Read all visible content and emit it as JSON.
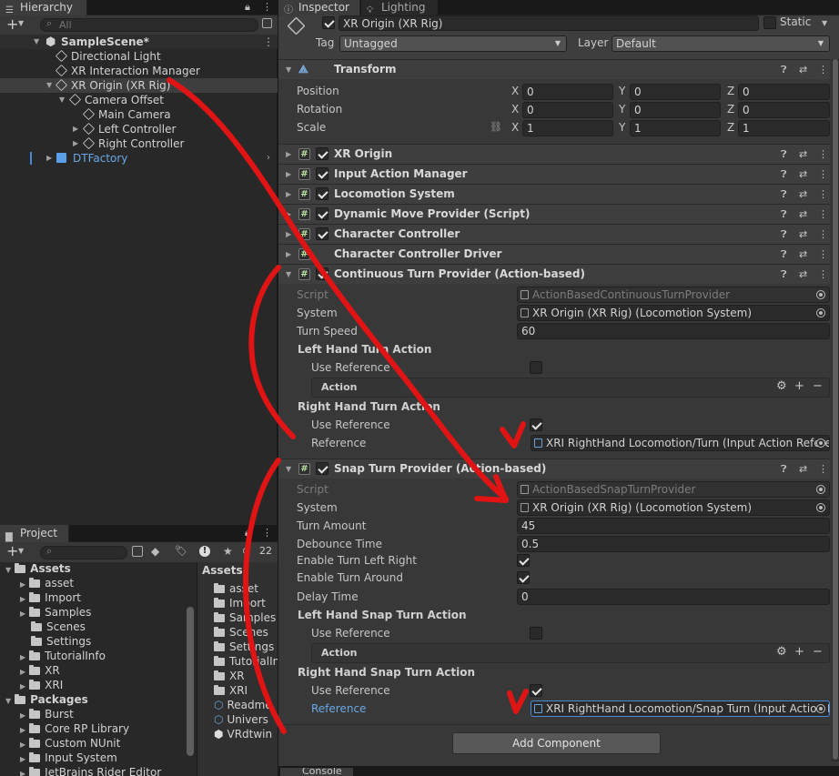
{
  "colors": {
    "annotation_red": "#e01414",
    "link_blue": "#69a8e6",
    "selected_row": "#3e3e3e"
  },
  "hierarchy": {
    "tab_label": "Hierarchy",
    "search_placeholder": "All",
    "scene": "SampleScene*",
    "items": [
      {
        "label": "Directional Light"
      },
      {
        "label": "XR Interaction Manager"
      },
      {
        "label": "XR Origin (XR Rig)"
      },
      {
        "label": "Camera Offset"
      },
      {
        "label": "Main Camera"
      },
      {
        "label": "Left Controller"
      },
      {
        "label": "Right Controller"
      },
      {
        "label": "DTFactory"
      }
    ]
  },
  "project": {
    "tab_label": "Project",
    "hidden_count": "22",
    "tree": {
      "assets_root": "Assets",
      "assets": [
        "asset",
        "Import",
        "Samples",
        "Scenes",
        "Settings",
        "TutorialInfo",
        "XR",
        "XRI"
      ],
      "packages_root": "Packages",
      "packages": [
        "Burst",
        "Core RP Library",
        "Custom NUnit",
        "Input System",
        "JetBrains Rider Editor"
      ]
    },
    "grid_header": "Assets",
    "grid_items": [
      "asset",
      "Import",
      "Samples",
      "Scenes",
      "Settings",
      "TutorialIn",
      "XR",
      "XRI",
      "Readme",
      "Univers",
      "VRdtwin"
    ]
  },
  "inspector": {
    "tab_label": "Inspector",
    "lighting_tab": "Lighting",
    "object_name": "XR Origin (XR Rig)",
    "static_label": "Static",
    "tag_label": "Tag",
    "tag_value": "Untagged",
    "layer_label": "Layer",
    "layer_value": "Default",
    "transform": {
      "title": "Transform",
      "position_label": "Position",
      "rotation_label": "Rotation",
      "scale_label": "Scale",
      "axis_x": "X",
      "axis_y": "Y",
      "axis_z": "Z",
      "position": [
        "0",
        "0",
        "0"
      ],
      "rotation": [
        "0",
        "0",
        "0"
      ],
      "scale": [
        "1",
        "1",
        "1"
      ]
    },
    "components": [
      "XR Origin",
      "Input Action Manager",
      "Locomotion System",
      "Dynamic Move Provider (Script)",
      "Character Controller",
      "Character Controller Driver"
    ],
    "continuous": {
      "title": "Continuous Turn Provider (Action-based)",
      "script_label": "Script",
      "script_value": "ActionBasedContinuousTurnProvider",
      "system_label": "System",
      "system_value": "XR Origin (XR Rig) (Locomotion System)",
      "turn_speed_label": "Turn Speed",
      "turn_speed_value": "60",
      "left_action_label": "Left Hand Turn Action",
      "left_use_ref_label": "Use Reference",
      "action_label": "Action",
      "right_action_label": "Right Hand Turn Action",
      "right_use_ref_label": "Use Reference",
      "reference_label": "Reference",
      "reference_value": "XRI RightHand Locomotion/Turn (Input Action Refere"
    },
    "snap": {
      "title": "Snap Turn Provider (Action-based)",
      "script_label": "Script",
      "script_value": "ActionBasedSnapTurnProvider",
      "system_label": "System",
      "system_value": "XR Origin (XR Rig) (Locomotion System)",
      "turn_amount_label": "Turn Amount",
      "turn_amount_value": "45",
      "debounce_label": "Debounce Time",
      "debounce_value": "0.5",
      "enable_lr_label": "Enable Turn Left Right",
      "enable_around_label": "Enable Turn Around",
      "delay_label": "Delay Time",
      "delay_value": "0",
      "left_action_label": "Left Hand Snap Turn Action",
      "left_use_ref_label": "Use Reference",
      "action_label": "Action",
      "right_action_label": "Right Hand Snap Turn Action",
      "right_use_ref_label": "Use Reference",
      "reference_label": "Reference",
      "reference_value": "XRI RightHand Locomotion/Snap Turn (Input Action R"
    },
    "add_component": "Add Component",
    "console_tab": "Console"
  }
}
